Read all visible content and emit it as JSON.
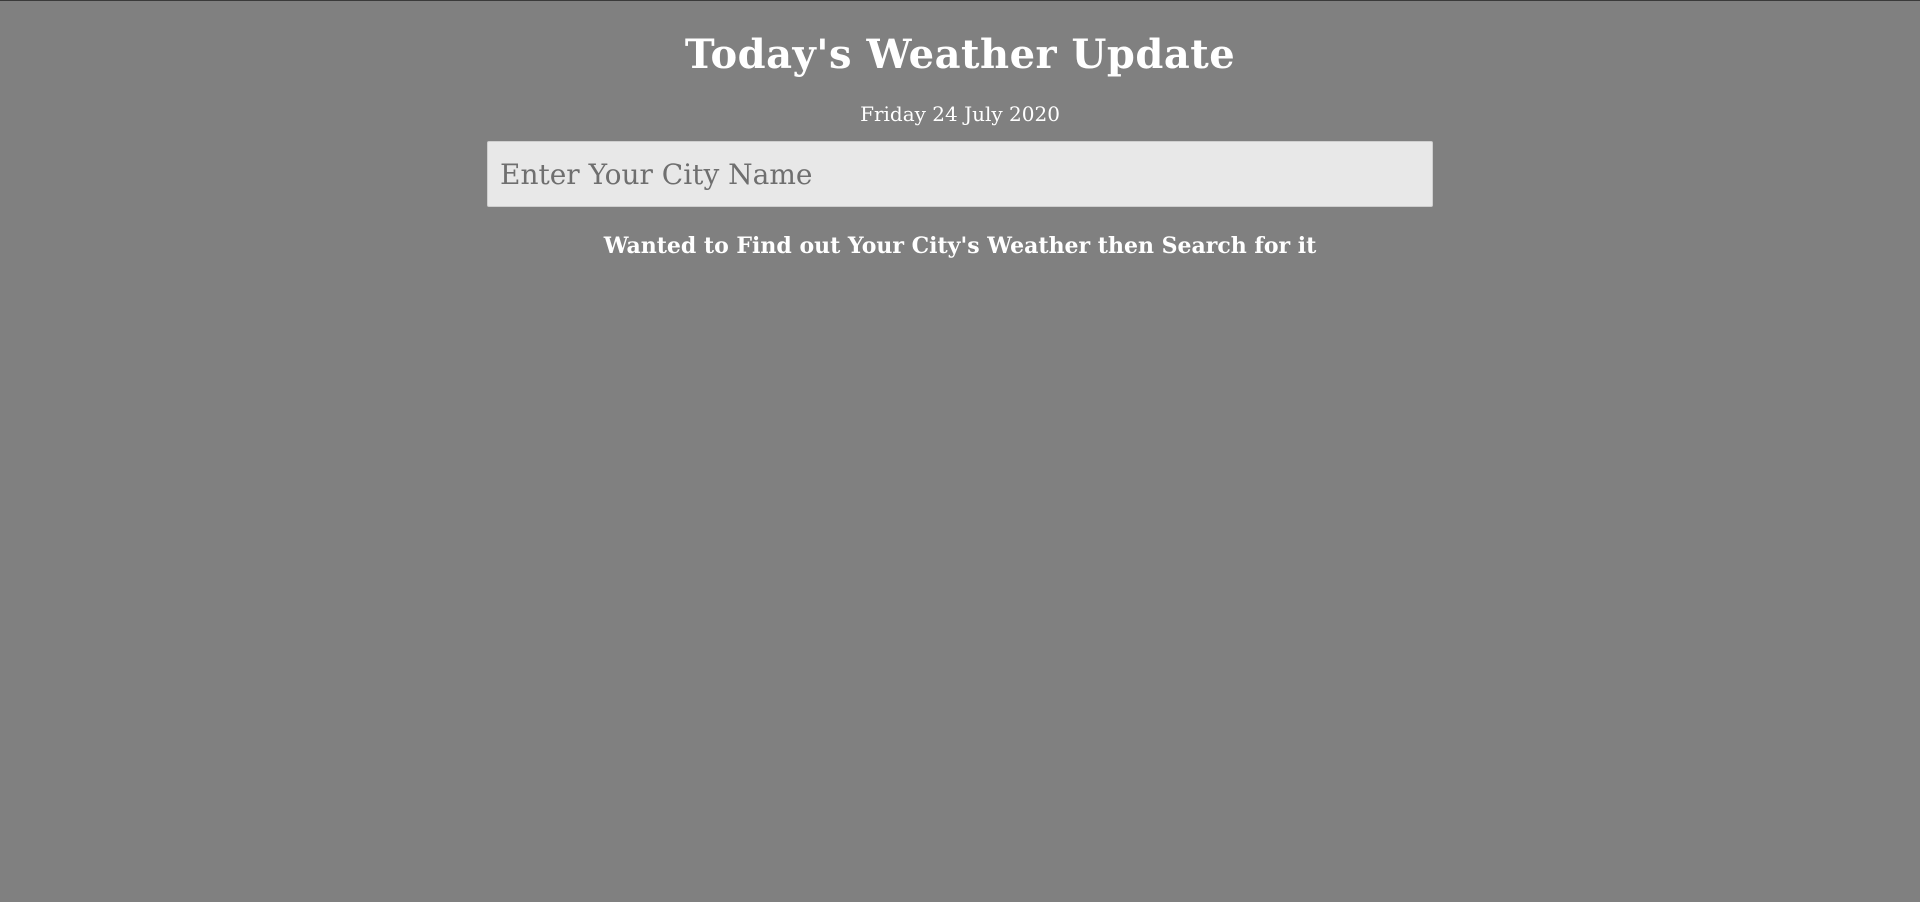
{
  "header": {
    "title": "Today's Weather Update",
    "date": "Friday 24 July 2020"
  },
  "search": {
    "placeholder": "Enter Your City Name",
    "value": ""
  },
  "hint": {
    "text": "Wanted to Find out Your City's Weather then Search for it"
  },
  "colors": {
    "background": "#808080",
    "text": "#ffffff",
    "input_background": "#e8e8e8"
  }
}
